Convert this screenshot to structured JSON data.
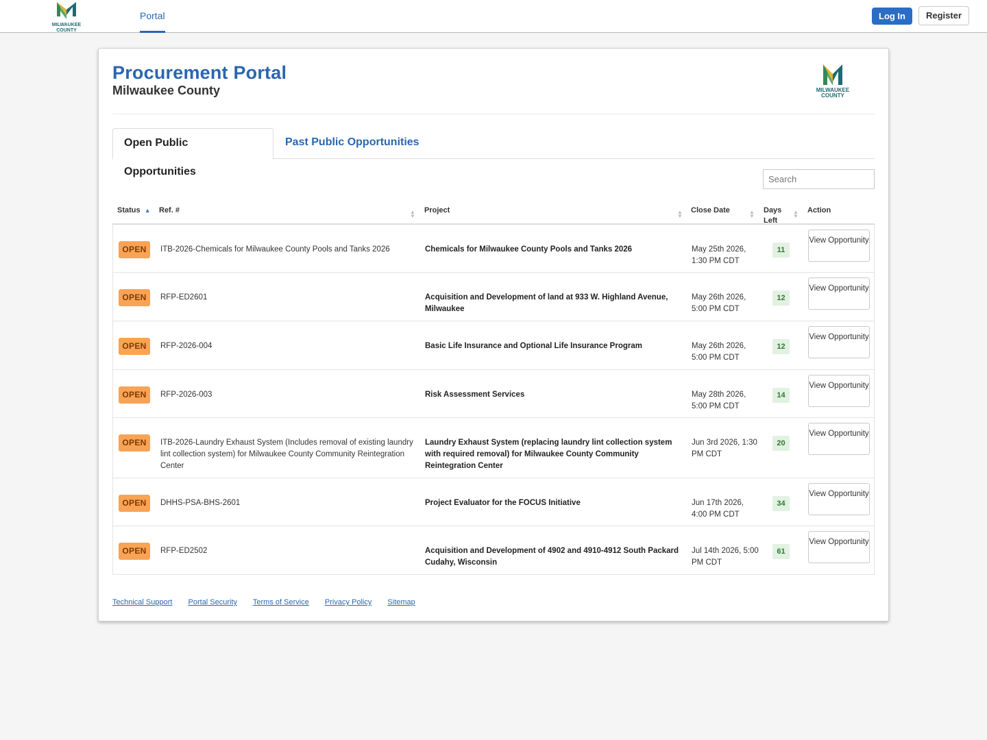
{
  "header": {
    "logo_text": [
      "MILWAUKEE",
      "COUNTY"
    ],
    "nav_portal": "Portal",
    "login_label": "Log In",
    "register_label": "Register"
  },
  "page": {
    "title": "Procurement Portal",
    "subtitle": "Milwaukee County"
  },
  "tabs": [
    {
      "label": "Open Public Opportunities",
      "active": true
    },
    {
      "label": "Past Public Opportunities",
      "active": false
    }
  ],
  "search": {
    "placeholder": "Search",
    "value": ""
  },
  "table": {
    "columns": {
      "status": "Status",
      "ref": "Ref. #",
      "project": "Project",
      "close_date": "Close Date",
      "days_left": "Days Left",
      "action": "Action"
    },
    "action_label": "View Opportunity",
    "rows": [
      {
        "status": "OPEN",
        "ref": "ITB-2026-Chemicals for Milwaukee County Pools and Tanks 2026",
        "project": "Chemicals for Milwaukee County Pools and Tanks 2026",
        "close_date": "May 25th 2026, 1:30 PM CDT",
        "days_left": "11"
      },
      {
        "status": "OPEN",
        "ref": "RFP-ED2601",
        "project": "Acquisition and Development of land at 933 W. Highland Avenue, Milwaukee",
        "close_date": "May 26th 2026, 5:00 PM CDT",
        "days_left": "12"
      },
      {
        "status": "OPEN",
        "ref": "RFP-2026-004",
        "project": "Basic Life Insurance and Optional Life Insurance Program",
        "close_date": "May 26th 2026, 5:00 PM CDT",
        "days_left": "12"
      },
      {
        "status": "OPEN",
        "ref": "RFP-2026-003",
        "project": "Risk Assessment Services",
        "close_date": "May 28th 2026, 5:00 PM CDT",
        "days_left": "14"
      },
      {
        "status": "OPEN",
        "ref": "ITB-2026-Laundry Exhaust System (Includes removal of existing laundry lint collection system) for Milwaukee County Community Reintegration Center",
        "project": "Laundry Exhaust System (replacing laundry lint collection system with required removal) for Milwaukee County Community Reintegration Center",
        "close_date": "Jun 3rd 2026, 1:30 PM CDT",
        "days_left": "20"
      },
      {
        "status": "OPEN",
        "ref": "DHHS-PSA-BHS-2601",
        "project": "Project Evaluator for the FOCUS Initiative",
        "close_date": "Jun 17th 2026, 4:00 PM CDT",
        "days_left": "34"
      },
      {
        "status": "OPEN",
        "ref": "RFP-ED2502",
        "project": "Acquisition and Development of 4902 and 4910-4912 South Packard Cudahy, Wisconsin",
        "close_date": "Jul 14th 2026, 5:00 PM CDT",
        "days_left": "61"
      }
    ]
  },
  "footer": {
    "links": [
      "Technical Support",
      "Portal Security",
      "Terms of Service",
      "Privacy Policy",
      "Sitemap"
    ]
  },
  "colors": {
    "brand_blue": "#2a66ae",
    "login_blue": "#2b6cc4",
    "open_badge": "#f9a354",
    "days_badge_bg": "#e2f1e2",
    "days_badge_text": "#2f7a2f",
    "logo_green": "#2e8b57",
    "logo_gold": "#e0b52a",
    "logo_teal": "#1c6c73"
  }
}
